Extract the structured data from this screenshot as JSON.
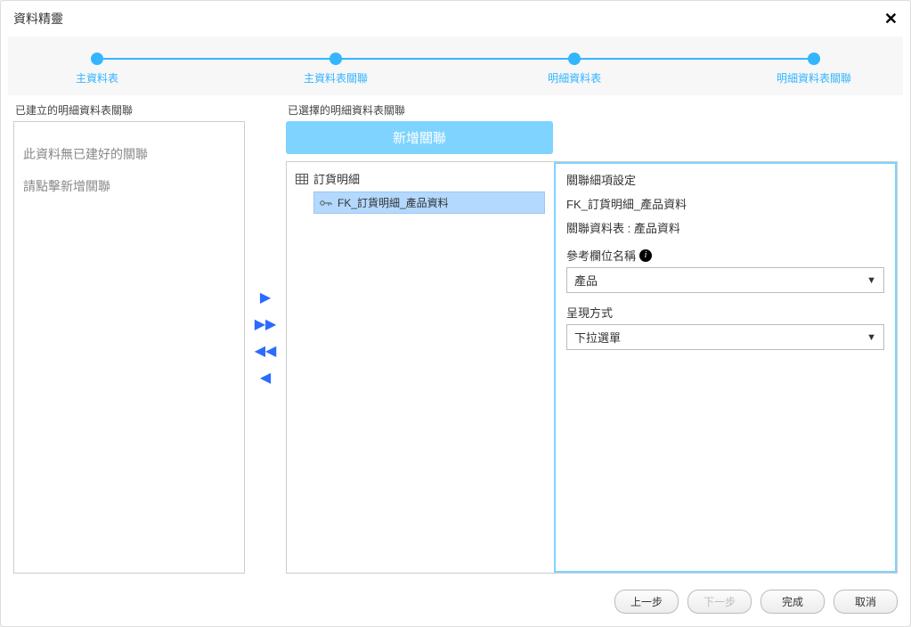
{
  "dialog": {
    "title": "資料精靈"
  },
  "steps": [
    {
      "label": "主資料表"
    },
    {
      "label": "主資料表關聯"
    },
    {
      "label": "明細資料表"
    },
    {
      "label": "明細資料表關聯"
    }
  ],
  "leftPanel": {
    "heading": "已建立的明細資料表關聯",
    "emptyLine1": "此資料無已建好的關聯",
    "emptyLine2": "請點擊新增關聯"
  },
  "rightPanel": {
    "heading": "已選擇的明細資料表關聯",
    "addButton": "新增關聯",
    "tree": {
      "rootLabel": "訂貨明細",
      "childLabel": "FK_訂貨明細_產品資料"
    },
    "details": {
      "title": "關聯細項設定",
      "fkName": "FK_訂貨明細_產品資料",
      "relatedTableLine": "關聯資料表 : 產品資料",
      "refFieldLabel": "參考欄位名稱",
      "refFieldValue": "產品",
      "displayModeLabel": "呈現方式",
      "displayModeValue": "下拉選單"
    }
  },
  "footer": {
    "prev": "上一步",
    "next": "下一步",
    "finish": "完成",
    "cancel": "取消"
  }
}
